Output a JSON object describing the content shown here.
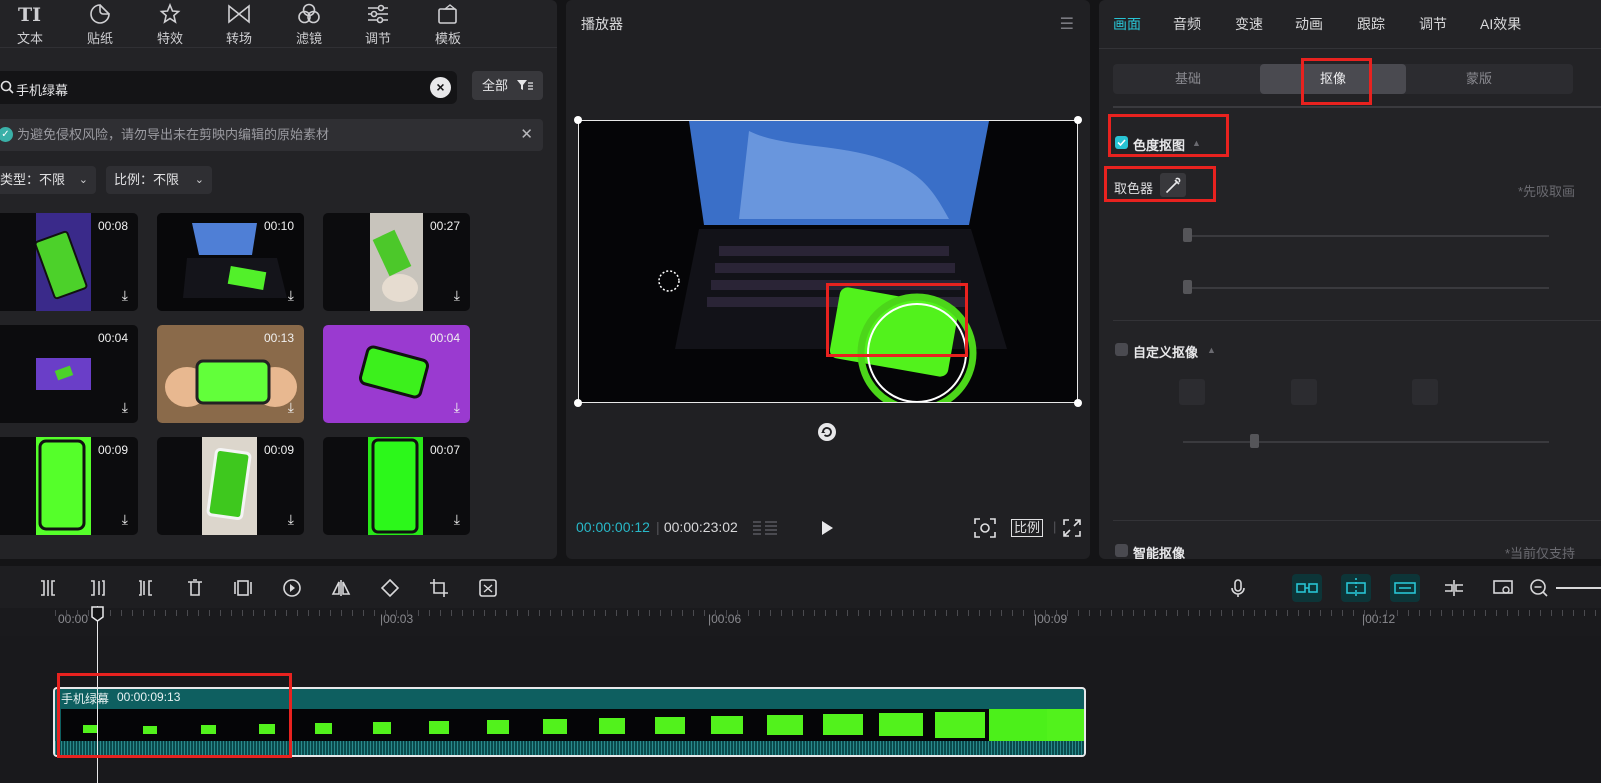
{
  "toolbar_top": {
    "items": [
      {
        "label": "文本",
        "icon": "text-icon"
      },
      {
        "label": "贴纸",
        "icon": "sticker-icon"
      },
      {
        "label": "特效",
        "icon": "effects-icon"
      },
      {
        "label": "转场",
        "icon": "transition-icon"
      },
      {
        "label": "滤镜",
        "icon": "filter-icon"
      },
      {
        "label": "调节",
        "icon": "adjust-icon"
      },
      {
        "label": "模板",
        "icon": "template-icon"
      }
    ]
  },
  "search": {
    "value": "手机绿幕",
    "filter_label": "全部"
  },
  "notice": {
    "text": "为避免侵权风险，请勿导出未在剪映内编辑的原始素材"
  },
  "filters": {
    "type": "类型：不限",
    "ratio": "比例：不限"
  },
  "media": {
    "items": [
      {
        "duration": "00:08"
      },
      {
        "duration": "00:10"
      },
      {
        "duration": "00:27"
      },
      {
        "duration": "00:04"
      },
      {
        "duration": "00:13"
      },
      {
        "duration": "00:04"
      },
      {
        "duration": "00:09"
      },
      {
        "duration": "00:09"
      },
      {
        "duration": "00:07"
      }
    ]
  },
  "player": {
    "title": "播放器",
    "current_time": "00:00:00:12",
    "total_time": "00:00:23:02",
    "ratio_label": "比例"
  },
  "inspector": {
    "tabs": [
      "画面",
      "音频",
      "变速",
      "动画",
      "跟踪",
      "调节",
      "AI效果"
    ],
    "active_tab": "画面",
    "sub_tabs": [
      "基础",
      "抠像",
      "蒙版"
    ],
    "active_sub_tab": "抠像",
    "chroma_key": {
      "label": "色度抠图",
      "checked": true,
      "picker_label": "取色器",
      "hint": "*先吸取画"
    },
    "custom_key": {
      "label": "自定义抠像",
      "checked": false
    },
    "smart_key": {
      "label": "智能抠像",
      "checked": false,
      "hint": "*当前仅支持"
    }
  },
  "timeline": {
    "ruler_labels": [
      "00:00",
      "|00:03",
      "|00:06",
      "|00:09",
      "|00:12"
    ],
    "clip": {
      "name": "手机绿幕",
      "duration": "00:00:09:13"
    }
  },
  "colors": {
    "accent": "#28c4d4",
    "highlight_box": "#e8221f",
    "clip": "#0e5f60",
    "green_screen": "#4cff1a"
  }
}
